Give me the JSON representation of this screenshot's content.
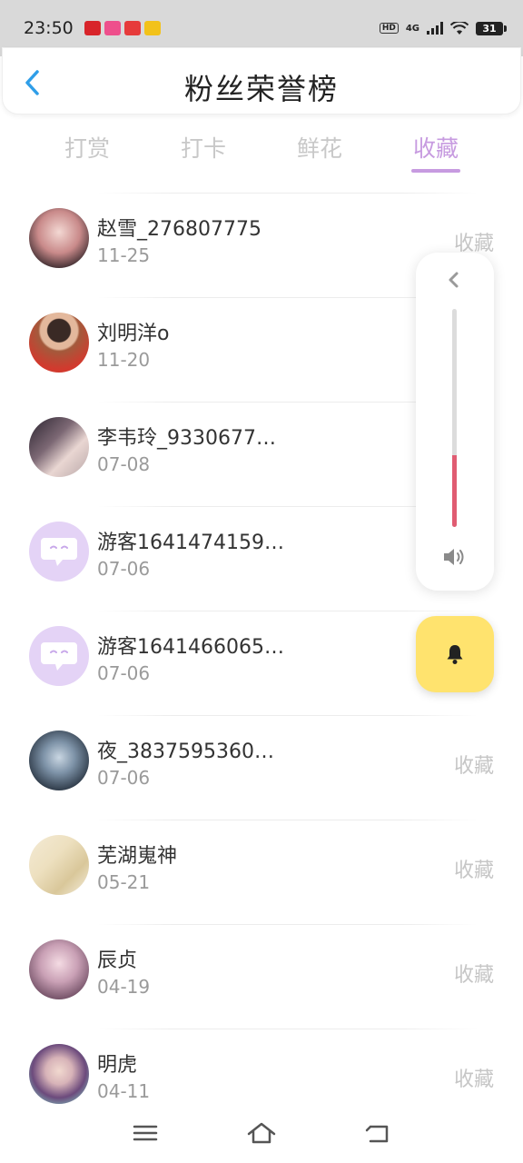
{
  "status_bar": {
    "time": "23:50",
    "hd": "HD",
    "network": "4G",
    "battery": "31"
  },
  "header": {
    "title": "粉丝荣誉榜",
    "back_icon": "chevron-left-icon"
  },
  "tabs": [
    {
      "label": "打赏",
      "active": false
    },
    {
      "label": "打卡",
      "active": false
    },
    {
      "label": "鲜花",
      "active": false
    },
    {
      "label": "收藏",
      "active": true
    }
  ],
  "colors": {
    "accent": "#c79be0",
    "bell": "#ffe36e",
    "volume": "#e05c72",
    "guest_avatar": "#e4d3f6"
  },
  "list": [
    {
      "name": "赵雪_276807775",
      "date": "11-25",
      "action": "收藏"
    },
    {
      "name": "刘明洋o",
      "date": "11-20",
      "action": ""
    },
    {
      "name": "李韦玲_9330677…",
      "date": "07-08",
      "action": ""
    },
    {
      "name": "游客1641474159…",
      "date": "07-06",
      "action": ""
    },
    {
      "name": "游客1641466065…",
      "date": "07-06",
      "action": ""
    },
    {
      "name": "夜_3837595360…",
      "date": "07-06",
      "action": "收藏"
    },
    {
      "name": "芜湖嵬神",
      "date": "05-21",
      "action": "收藏"
    },
    {
      "name": "辰贞",
      "date": "04-19",
      "action": "收藏"
    },
    {
      "name": "明虎",
      "date": "04-11",
      "action": "收藏"
    }
  ],
  "volume": {
    "level": 0.33,
    "icon": "speaker-icon"
  },
  "nav": {
    "menu_icon": "menu-icon",
    "home_icon": "home-icon",
    "back_icon": "back-icon"
  }
}
